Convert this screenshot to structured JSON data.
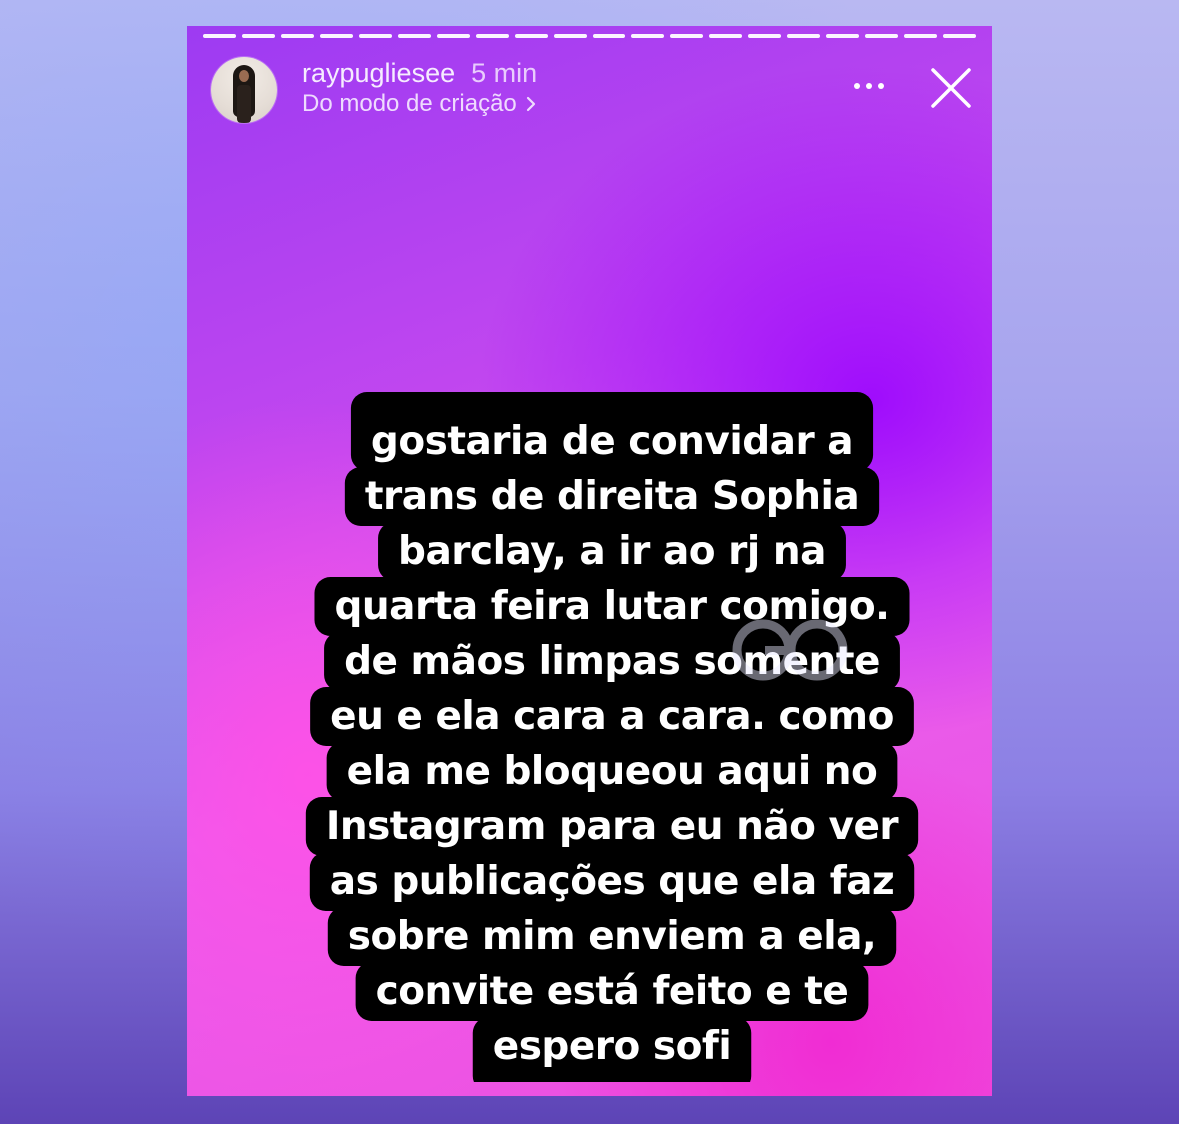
{
  "story": {
    "username": "raypugliesee",
    "timestamp": "5 min",
    "source_label": "Do modo de criação",
    "progress_segments_total": 20,
    "progress_segments_done": 20,
    "text_lines": [
      "gostaria de convidar a",
      "trans de direita Sophia",
      "barclay, a ir ao rj na",
      "quarta feira lutar comigo.",
      "de mãos limpas somente",
      "eu e ela cara a cara. como",
      "ela me bloqueou aqui no",
      "Instagram para eu não ver",
      "as publicações que ela faz",
      "sobre mim enviem a ela,",
      "convite está feito e te",
      "espero sofi"
    ]
  },
  "icons": {
    "more": "more-options-icon",
    "close": "close-icon",
    "chevron": "chevron-right-icon",
    "watermark": "watermark-logo-icon"
  },
  "colors": {
    "story_gradient_top": "#9d3bf2",
    "story_gradient_bottom": "#ef4ddd",
    "text_background": "#000000",
    "text": "#ffffff"
  }
}
